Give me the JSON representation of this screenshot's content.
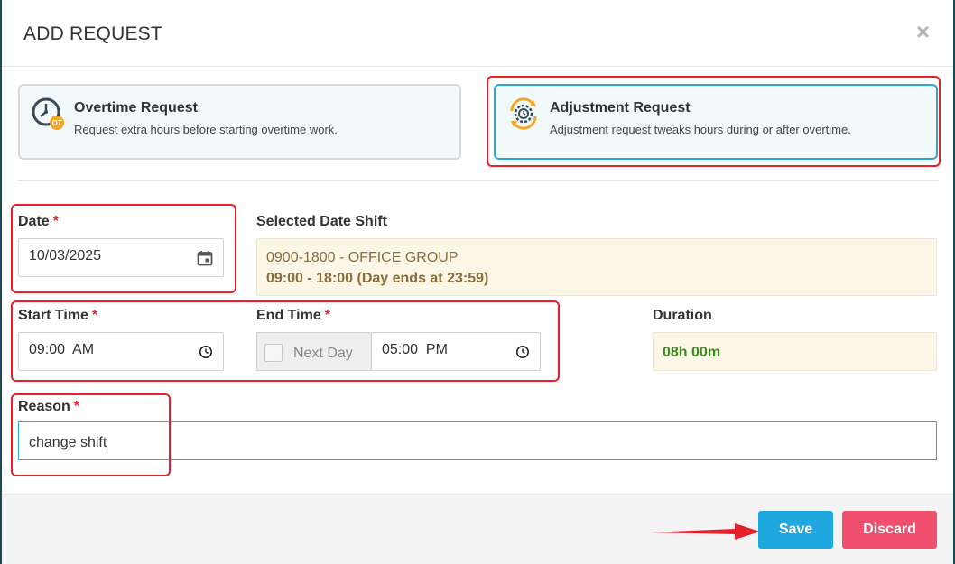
{
  "modal": {
    "title": "ADD REQUEST",
    "close_label": "×"
  },
  "request_types": [
    {
      "title": "Overtime Request",
      "description": "Request extra hours before starting overtime work.",
      "icon": "overtime-clock-icon",
      "icon_badge": "OT",
      "selected": false
    },
    {
      "title": "Adjustment Request",
      "description": "Adjustment request tweaks hours during or after overtime.",
      "icon": "adjustment-gear-clock-icon",
      "selected": true
    }
  ],
  "form": {
    "date": {
      "label": "Date",
      "required_mark": "*",
      "value": "10/03/2025"
    },
    "selected_shift": {
      "label": "Selected Date Shift",
      "name": "0900-1800 - OFFICE GROUP",
      "hours": "09:00 - 18:00 (Day ends at 23:59)"
    },
    "start_time": {
      "label": "Start Time",
      "required_mark": "*",
      "value": "09:00  AM"
    },
    "end_time": {
      "label": "End Time",
      "required_mark": "*",
      "value": "05:00  PM",
      "next_day_label": "Next Day",
      "next_day_checked": false
    },
    "duration": {
      "label": "Duration",
      "value": "08h 00m"
    },
    "reason": {
      "label": "Reason",
      "required_mark": "*",
      "value": "change shift"
    }
  },
  "footer": {
    "save_label": "Save",
    "discard_label": "Discard"
  },
  "colors": {
    "accent_blue": "#1fa8e0",
    "discard_pink": "#f0506e",
    "required_red": "#e8202a",
    "shift_text": "#8a6d3b",
    "duration_green": "#3c8a1e",
    "annotation_red": "#e8202a"
  }
}
